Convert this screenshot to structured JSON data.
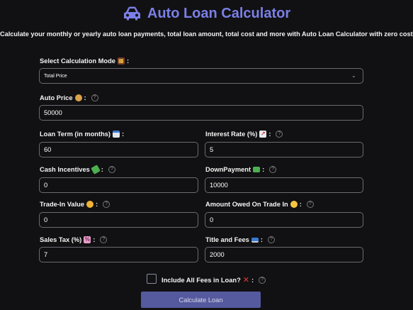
{
  "header": {
    "title": "Auto Loan Calculator",
    "subtitle": "Calculate your monthly or yearly auto loan payments, total loan amount, total cost and more with Auto Loan Calculator with zero cost."
  },
  "mode": {
    "label": "Select Calculation Mode",
    "selected": "Total Price"
  },
  "fields": {
    "auto_price": {
      "label": "Auto Price",
      "value": "50000"
    },
    "loan_term": {
      "label": "Loan Term (in months)",
      "value": "60"
    },
    "interest_rate": {
      "label": "Interest Rate (%)",
      "value": "5"
    },
    "cash_incentives": {
      "label": "Cash Incentives",
      "value": "0"
    },
    "down_payment": {
      "label": "DownPayment",
      "value": "10000"
    },
    "trade_in_value": {
      "label": "Trade-In Value",
      "value": "0"
    },
    "amount_owed": {
      "label": "Amount Owed On Trade In",
      "value": "0"
    },
    "sales_tax": {
      "label": "Sales Tax (%)",
      "value": "7"
    },
    "title_fees": {
      "label": "Title and Fees",
      "value": "2000"
    }
  },
  "include_fees": {
    "label": "Include All Fees in Loan?",
    "checked": false
  },
  "button": {
    "label": "Calculate Loan"
  },
  "colors": {
    "accent": "#7b7fe6",
    "button": "#555a9e",
    "background": "#111113"
  }
}
